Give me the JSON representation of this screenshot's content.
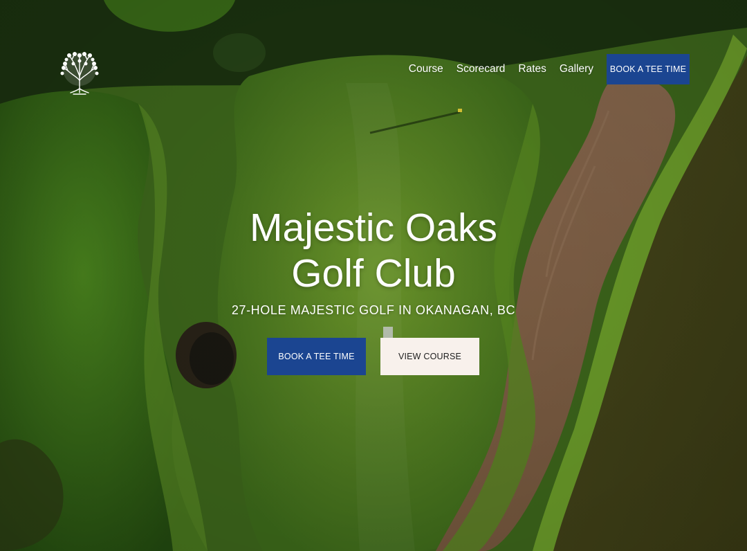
{
  "site": {
    "logo_icon": "oak-tree-icon"
  },
  "nav": {
    "links": [
      "Course",
      "Scorecard",
      "Rates",
      "Gallery"
    ],
    "cta_label": "BOOK A TEE TIME"
  },
  "hero": {
    "title_line1": "Majestic Oaks",
    "title_line2": "Golf Club",
    "subtitle": "27-HOLE MAJESTIC GOLF IN OKANAGAN, BC",
    "primary_button": "BOOK A TEE TIME",
    "secondary_button": "VIEW COURSE"
  },
  "colors": {
    "brand_blue": "#1b4591",
    "light_button": "#f8f1ec",
    "text": "#ffffff"
  }
}
